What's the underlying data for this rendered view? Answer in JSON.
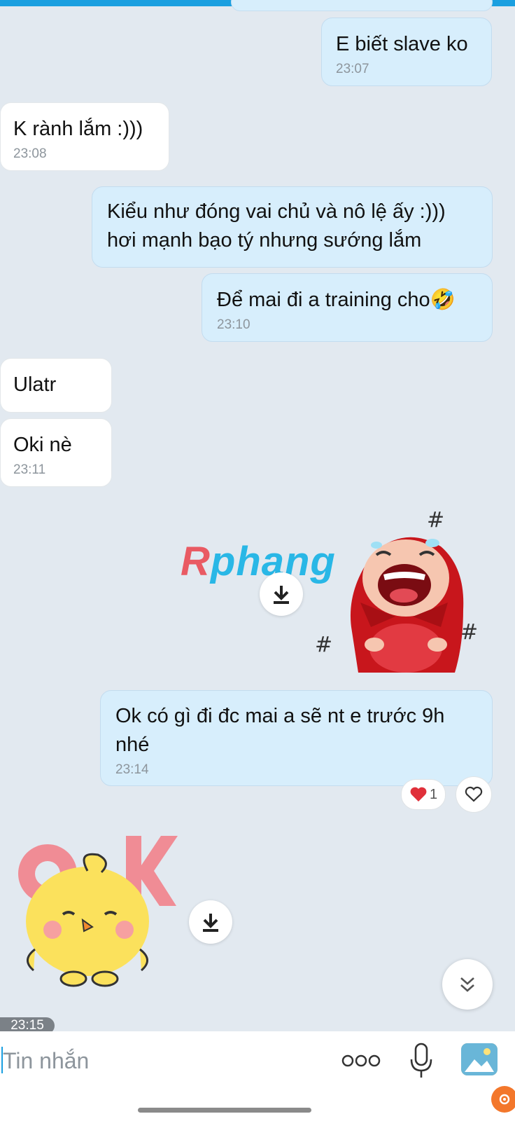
{
  "conversation": {
    "messages": [
      {
        "direction": "out",
        "text": "E biết slave ko",
        "time": "23:07"
      },
      {
        "direction": "in",
        "text": "K rành lắm :)))",
        "time": "23:08"
      },
      {
        "direction": "out",
        "text": "Kiểu như đóng vai chủ và nô lệ ấy :)))\nhơi mạnh bạo tý nhưng sướng lắm",
        "time": ""
      },
      {
        "direction": "out",
        "text": "Để mai đi a training cho🤣",
        "time": "23:10"
      },
      {
        "direction": "in",
        "text": "Ulatr",
        "time": ""
      },
      {
        "direction": "in",
        "text": "Oki nè",
        "time": "23:11"
      },
      {
        "direction": "out",
        "text": "Ok có gì đi đc mai a sẽ nt e trước 9h\nnhé",
        "time": "23:14"
      }
    ],
    "reaction": {
      "icon": "heart-icon",
      "count": "1"
    },
    "last_time_chip": "23:15"
  },
  "watermark": {
    "r": "R",
    "rest": "phang"
  },
  "composer": {
    "placeholder": "Tin nhắn",
    "icons": [
      "more-icon",
      "microphone-icon",
      "image-icon"
    ]
  },
  "colors": {
    "accent": "#1a9fe0",
    "background": "#e2e9f0",
    "outgoing_bubble": "#d7eefc",
    "incoming_bubble": "#ffffff"
  }
}
